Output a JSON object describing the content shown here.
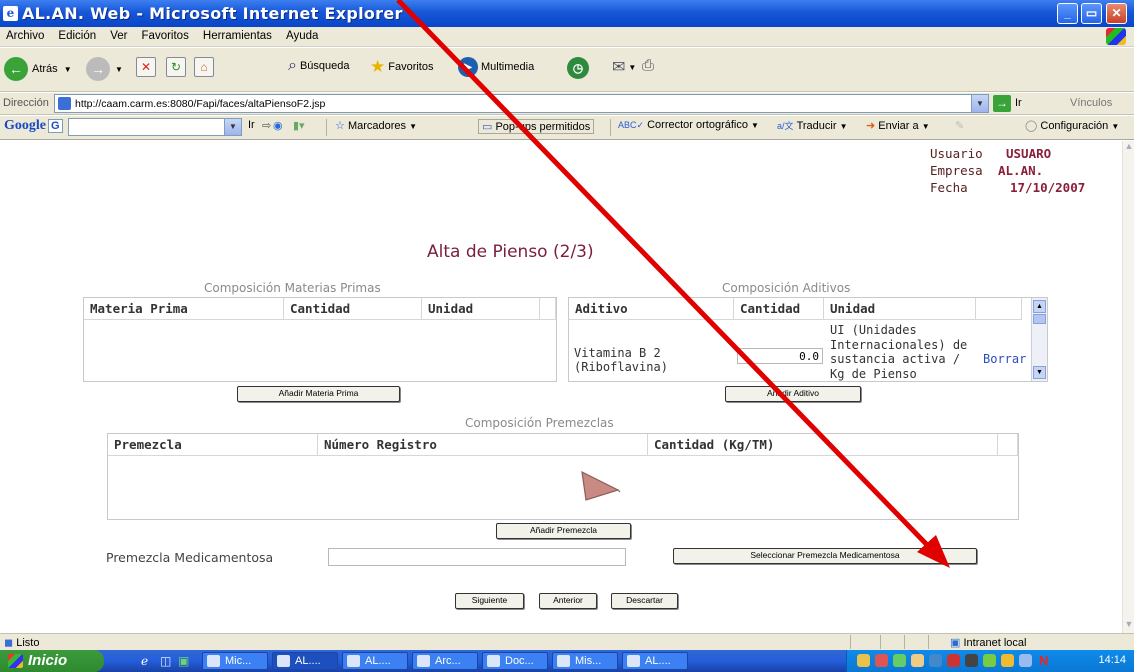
{
  "window": {
    "title": "AL.AN. Web - Microsoft Internet Explorer",
    "icon": "ie-icon"
  },
  "menu": [
    "Archivo",
    "Edición",
    "Ver",
    "Favoritos",
    "Herramientas",
    "Ayuda"
  ],
  "toolbar": {
    "back": "Atrás",
    "search": "Búsqueda",
    "favorites": "Favoritos",
    "multimedia": "Multimedia"
  },
  "address": {
    "label": "Dirección",
    "url": "http://caam.carm.es:8080/Fapi/faces/altaPiensoF2.jsp",
    "go": "Ir",
    "links": "Vínculos"
  },
  "google": {
    "logo": "Google",
    "g": "G",
    "go": "Ir",
    "bookmarks": "Marcadores",
    "popups": "Pop-ups permitidos",
    "spell": "Corrector ortográfico",
    "translate": "Traducir",
    "send": "Enviar a",
    "config": "Configuración"
  },
  "user": {
    "usuario_label": "Usuario",
    "usuario": "USUARO",
    "empresa_label": "Empresa",
    "empresa": "AL.AN.",
    "fecha_label": "Fecha",
    "fecha": "17/10/2007"
  },
  "page": {
    "title": "Alta de Pienso (2/3)"
  },
  "materias": {
    "title": "Composición Materias Primas",
    "columns": [
      "Materia Prima",
      "Cantidad",
      "Unidad"
    ],
    "add_button": "Añadir Materia Prima"
  },
  "aditivos": {
    "title": "Composición Aditivos",
    "columns": [
      "Aditivo",
      "Cantidad",
      "Unidad"
    ],
    "rows": [
      {
        "aditivo_line1": "Vitamina B 2",
        "aditivo_line2": "(Riboflavina)",
        "cantidad": "0.0",
        "unidad_lines": [
          "UI (Unidades",
          "Internacionales) de",
          "sustancia activa /",
          "Kg de Pienso"
        ],
        "action": "Borrar"
      }
    ],
    "add_button": "Añadir Aditivo"
  },
  "premezclas": {
    "title": "Composición Premezclas",
    "columns": [
      "Premezcla",
      "Número Registro",
      "Cantidad (Kg/TM)"
    ],
    "add_button": "Añadir Premezcla"
  },
  "medicamentosa": {
    "label": "Premezcla Medicamentosa",
    "value": "",
    "select_button": "Seleccionar Premezcla Medicamentosa"
  },
  "nav_buttons": {
    "next": "Siguiente",
    "prev": "Anterior",
    "discard": "Descartar"
  },
  "status": {
    "text": "Listo",
    "zone": "Intranet local"
  },
  "taskbar": {
    "start": "Inicio",
    "tasks": [
      "Mic...",
      "AL....",
      "AL....",
      "Arc...",
      "Doc...",
      "Mis...",
      "AL...."
    ],
    "clock": "14:14"
  },
  "colors": {
    "title_text": "#7a1e3a",
    "annotation_arrow": "#e00000"
  }
}
